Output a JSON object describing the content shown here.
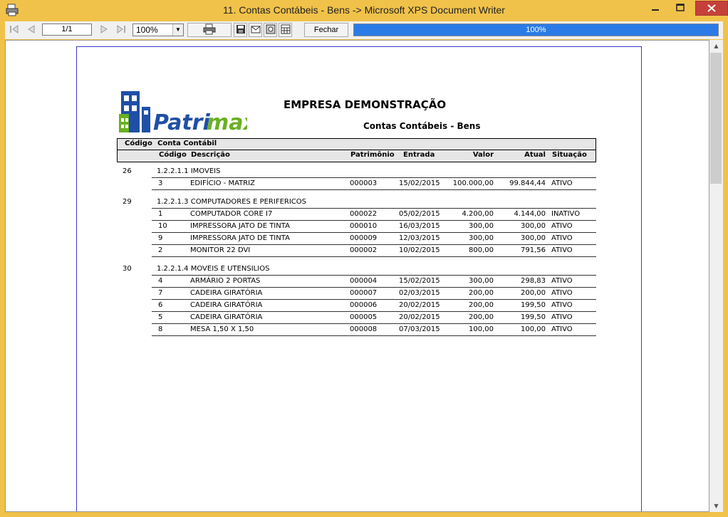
{
  "window": {
    "title": "11. Contas Contábeis - Bens -> Microsoft XPS Document Writer"
  },
  "toolbar": {
    "page_indicator": "1/1",
    "zoom": "100%",
    "close_label": "Fechar",
    "progress_text": "100%",
    "progress": 1.0
  },
  "report": {
    "logo_text": "Patrimax",
    "company": "EMPRESA DEMONSTRAÇÃO",
    "title": "Contas Contábeis - Bens",
    "header": {
      "codigo": "Código",
      "conta": "Conta Contábil",
      "sub_codigo": "Código",
      "descricao": "Descrição",
      "patrimonio": "Patrimônio",
      "entrada": "Entrada",
      "valor": "Valor",
      "atual": "Atual",
      "situacao": "Situação"
    },
    "groups": [
      {
        "codigo": "26",
        "conta": "1.2.2.1.1 IMOVEIS",
        "items": [
          {
            "codigo": "3",
            "descricao": "EDIFÍCIO - MATRIZ",
            "patrimonio": "000003",
            "entrada": "15/02/2015",
            "valor": "100.000,00",
            "atual": "99.844,44",
            "situacao": "ATIVO"
          }
        ]
      },
      {
        "codigo": "29",
        "conta": "1.2.2.1.3 COMPUTADORES E PERIFERICOS",
        "items": [
          {
            "codigo": "1",
            "descricao": "COMPUTADOR CORE I7",
            "patrimonio": "000022",
            "entrada": "05/02/2015",
            "valor": "4.200,00",
            "atual": "4.144,00",
            "situacao": "INATIVO"
          },
          {
            "codigo": "10",
            "descricao": "IMPRESSORA JATO DE TINTA",
            "patrimonio": "000010",
            "entrada": "16/03/2015",
            "valor": "300,00",
            "atual": "300,00",
            "situacao": "ATIVO"
          },
          {
            "codigo": "9",
            "descricao": "IMPRESSORA JATO DE TINTA",
            "patrimonio": "000009",
            "entrada": "12/03/2015",
            "valor": "300,00",
            "atual": "300,00",
            "situacao": "ATIVO"
          },
          {
            "codigo": "2",
            "descricao": "MONITOR 22 DVI",
            "patrimonio": "000002",
            "entrada": "10/02/2015",
            "valor": "800,00",
            "atual": "791,56",
            "situacao": "ATIVO"
          }
        ]
      },
      {
        "codigo": "30",
        "conta": "1.2.2.1.4 MOVEIS E UTENSILIOS",
        "items": [
          {
            "codigo": "4",
            "descricao": "ARMÁRIO 2 PORTAS",
            "patrimonio": "000004",
            "entrada": "15/02/2015",
            "valor": "300,00",
            "atual": "298,83",
            "situacao": "ATIVO"
          },
          {
            "codigo": "7",
            "descricao": "CADEIRA GIRATÓRIA",
            "patrimonio": "000007",
            "entrada": "02/03/2015",
            "valor": "200,00",
            "atual": "200,00",
            "situacao": "ATIVO"
          },
          {
            "codigo": "6",
            "descricao": "CADEIRA GIRATÓRIA",
            "patrimonio": "000006",
            "entrada": "20/02/2015",
            "valor": "200,00",
            "atual": "199,50",
            "situacao": "ATIVO"
          },
          {
            "codigo": "5",
            "descricao": "CADEIRA GIRATÓRIA",
            "patrimonio": "000005",
            "entrada": "20/02/2015",
            "valor": "200,00",
            "atual": "199,50",
            "situacao": "ATIVO"
          },
          {
            "codigo": "8",
            "descricao": "MESA 1,50 X 1,50",
            "patrimonio": "000008",
            "entrada": "07/03/2015",
            "valor": "100,00",
            "atual": "100,00",
            "situacao": "ATIVO"
          }
        ]
      }
    ]
  }
}
